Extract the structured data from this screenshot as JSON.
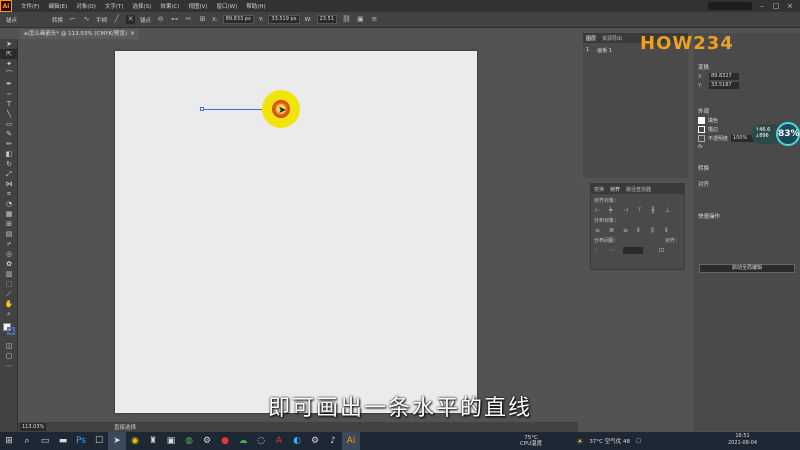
{
  "menubar": {
    "app_badge": "Ai",
    "items": [
      "文件(F)",
      "编辑(E)",
      "对象(O)",
      "文字(T)",
      "选择(S)",
      "效果(C)",
      "视图(V)",
      "窗口(W)",
      "帮助(H)"
    ]
  },
  "controlbar": {
    "label_path": "锚点",
    "label_convert": "转换",
    "label_handle": "手柄",
    "label_anchor": "锚点",
    "x_value": "89.833 px",
    "y_value": "33.519 px",
    "w_value": "23.51"
  },
  "document": {
    "tab_title": "ai怎么画箭头* @ 113.03% (CMYK/预览)"
  },
  "subtitle": "即可画出一条水平的直线",
  "statusbar": {
    "zoom": "113.03%",
    "tool_name": "直接选择"
  },
  "layers_panel": {
    "tabs": [
      "图层",
      "资源导出"
    ],
    "row_index": "1",
    "row_name": "画板 1"
  },
  "align_panel": {
    "tabs": [
      "变换",
      "对齐",
      "路径查找器"
    ],
    "section_align_objects": "对齐对象：",
    "section_distribute_objects": "分布对象：",
    "section_distribute_spacing": "分布间距：",
    "align_to": "对齐："
  },
  "right_panel": {
    "logo": "HOW234",
    "transform_title": "变换",
    "x_value": "89.8327",
    "y_value": "33.5187",
    "appearance_title": "外观",
    "fill_label": "填色",
    "stroke_label": "描边",
    "opacity_label": "不透明度",
    "opacity_value": "100%",
    "fx_label": "fx",
    "convert_title": "转换",
    "align_title": "对齐",
    "batch_title": "快速操作",
    "batch_button": "启动全局编辑"
  },
  "perf_widget": {
    "speed_up": "↑46.6",
    "speed_down": "↓896",
    "percent": "83%"
  },
  "taskbar": {
    "cpu_temp": "75°C",
    "cpu_label": "CPU温度",
    "weather": "37°C 空气优 48",
    "time": "16:51",
    "date": "2021-08-04"
  }
}
